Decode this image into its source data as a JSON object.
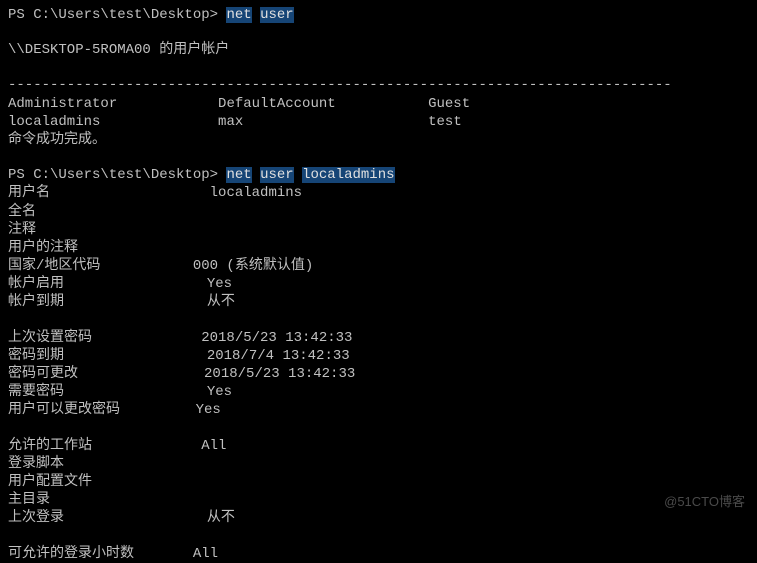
{
  "prompt1": {
    "path": "PS C:\\Users\\test\\Desktop> ",
    "cmd_parts": [
      "net",
      "user"
    ]
  },
  "header_line": "\\\\DESKTOP-5ROMA00 的用户帐户",
  "dashes": "-------------------------------------------------------------------------------",
  "users_row1": {
    "col1": "Administrator",
    "col2": "DefaultAccount",
    "col3": "Guest"
  },
  "users_row2": {
    "col1": "localadmins",
    "col2": "max",
    "col3": "test"
  },
  "success_msg": "命令成功完成。",
  "prompt2": {
    "path": "PS C:\\Users\\test\\Desktop> ",
    "cmd_parts": [
      "net",
      "user",
      "localadmins"
    ]
  },
  "details": [
    {
      "label": "用户名",
      "value": "localadmins"
    },
    {
      "label": "全名",
      "value": ""
    },
    {
      "label": "注释",
      "value": ""
    },
    {
      "label": "用户的注释",
      "value": ""
    },
    {
      "label": "国家/地区代码",
      "value": "000 (系统默认值)"
    },
    {
      "label": "帐户启用",
      "value": "Yes"
    },
    {
      "label": "帐户到期",
      "value": "从不"
    }
  ],
  "details2": [
    {
      "label": "上次设置密码",
      "value": "2018/5/23 13:42:33"
    },
    {
      "label": "密码到期",
      "value": "2018/7/4 13:42:33"
    },
    {
      "label": "密码可更改",
      "value": "2018/5/23 13:42:33"
    },
    {
      "label": "需要密码",
      "value": "Yes"
    },
    {
      "label": "用户可以更改密码",
      "value": "Yes"
    }
  ],
  "details3": [
    {
      "label": "允许的工作站",
      "value": "All"
    },
    {
      "label": "登录脚本",
      "value": ""
    },
    {
      "label": "用户配置文件",
      "value": ""
    },
    {
      "label": "主目录",
      "value": ""
    },
    {
      "label": "上次登录",
      "value": "从不"
    }
  ],
  "details4": [
    {
      "label": "可允许的登录小时数",
      "value": "All"
    }
  ],
  "watermark": "@51CTO博客"
}
